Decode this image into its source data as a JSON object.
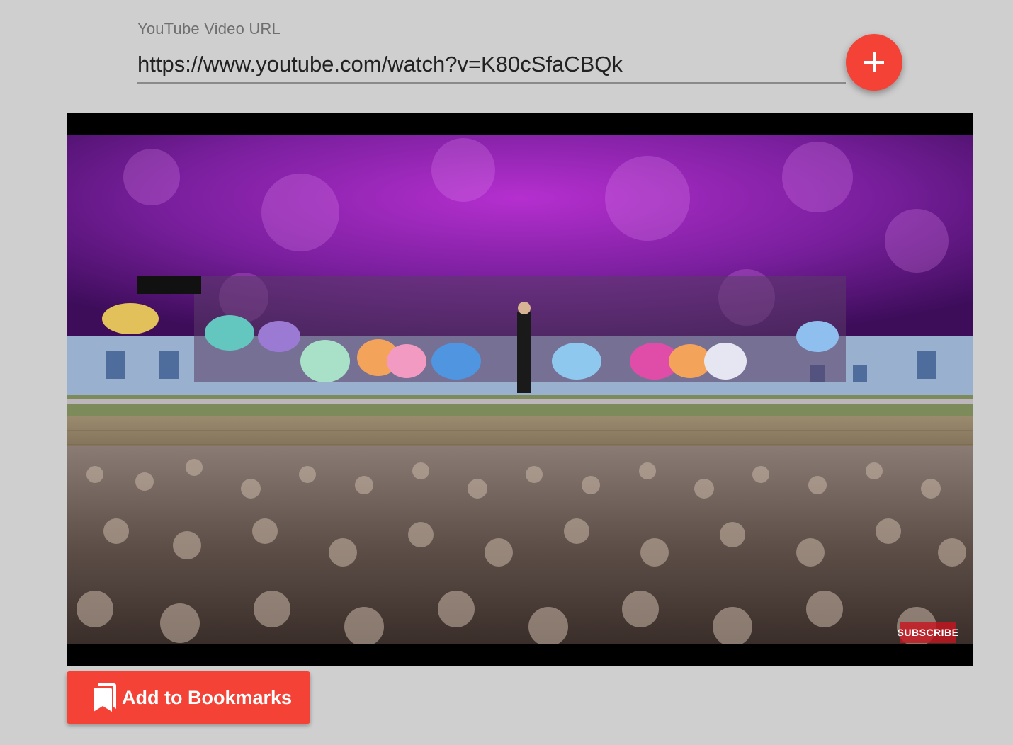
{
  "url_field": {
    "label": "YouTube Video URL",
    "value": "https://www.youtube.com/watch?v=K80cSfaCBQk"
  },
  "add_button": {
    "icon": "plus-icon",
    "color": "#f44336"
  },
  "video": {
    "overlay_badge": "SUBSCRIBE"
  },
  "bookmark_button": {
    "label": "Add to Bookmarks",
    "icon": "bookmarks-icon",
    "color": "#f44336"
  }
}
